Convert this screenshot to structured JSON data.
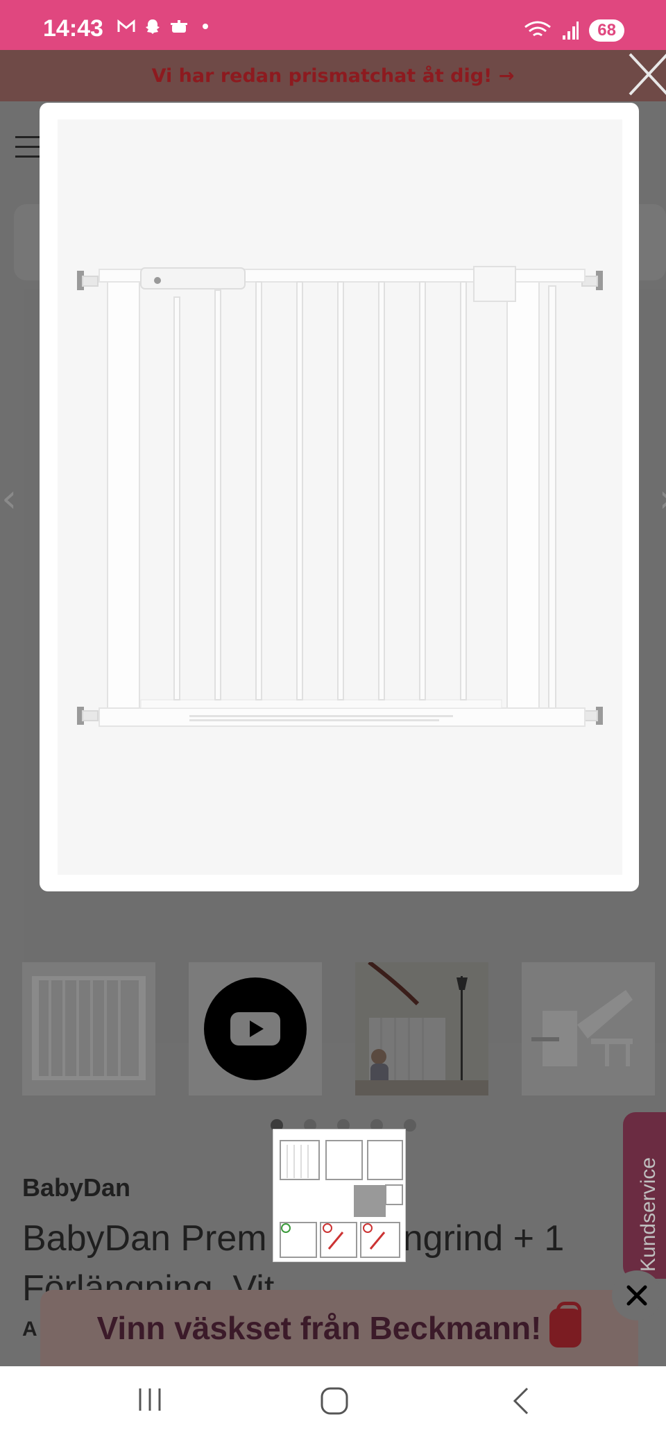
{
  "status_bar": {
    "time": "14:43",
    "battery": "68",
    "icons": [
      "gmail-icon",
      "snapchat-icon",
      "cooking-pot-icon",
      "dot-icon",
      "wifi-icon",
      "signal-icon"
    ]
  },
  "promo_bar": {
    "text": "Vi har redan prismatchat åt dig! →"
  },
  "product": {
    "brand": "BabyDan",
    "title": "BabyDan Premier Spärrgrind + 1 Förlängning, Vit",
    "title_visible_left": "BabyDan Prem",
    "title_visible_right": "ngrind + 1",
    "title_line2": "Förlängning, Vit",
    "subtitle_fragment": "A"
  },
  "gallery": {
    "thumbnails": [
      "gate-front",
      "youtube-video",
      "gate-stairs-with-child",
      "gate-fitting-detail"
    ],
    "dots": 5,
    "active_dot": 0
  },
  "kundservice": {
    "label": "Kundservice"
  },
  "popup": {
    "text": "Vinn väskset från Beckmann!"
  },
  "colors": {
    "status_bar": "#e0477f",
    "promo_text": "#8d1a1f",
    "overlay": "#6f6f6f",
    "popup_text": "#3b1a29"
  }
}
